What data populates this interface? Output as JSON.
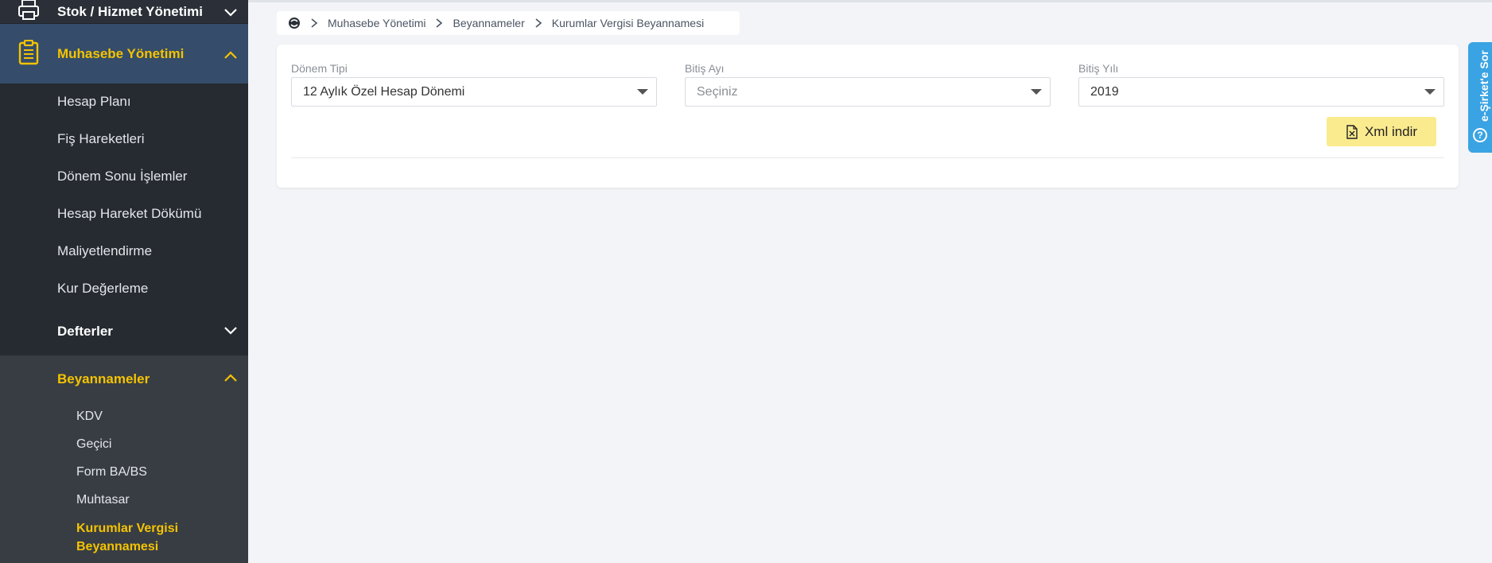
{
  "sidebar": {
    "top_item": {
      "label": "Stok / Hizmet Yönetimi",
      "icon": "printer-icon"
    },
    "active_section": {
      "label": "Muhasebe Yönetimi",
      "icon": "clipboard-icon"
    },
    "sub_items": [
      {
        "label": "Hesap Planı"
      },
      {
        "label": "Fiş Hareketleri"
      },
      {
        "label": "Dönem Sonu İşlemler"
      },
      {
        "label": "Hesap Hareket Dökümü"
      },
      {
        "label": "Maliyetlendirme"
      },
      {
        "label": "Kur Değerleme"
      }
    ],
    "defterler": {
      "label": "Defterler"
    },
    "beyannameler": {
      "label": "Beyannameler",
      "items": [
        {
          "label": "KDV"
        },
        {
          "label": "Geçici"
        },
        {
          "label": "Form BA/BS"
        },
        {
          "label": "Muhtasar"
        },
        {
          "label": "Kurumlar Vergisi Beyannamesi"
        }
      ]
    }
  },
  "breadcrumb": {
    "items": [
      "Muhasebe Yönetimi",
      "Beyannameler",
      "Kurumlar Vergisi Beyannamesi"
    ]
  },
  "form": {
    "donem_tipi": {
      "label": "Dönem Tipi",
      "value": "12 Aylık Özel Hesap Dönemi"
    },
    "bitis_ayi": {
      "label": "Bitiş Ayı",
      "placeholder": "Seçiniz"
    },
    "bitis_yili": {
      "label": "Bitiş Yılı",
      "value": "2019"
    },
    "xml_button": {
      "label": "Xml indir"
    }
  },
  "side_tab": {
    "label": "e-Şirket'e Sor"
  },
  "colors": {
    "sidebar_bg": "#262b31",
    "active_section_bg": "#354d6a",
    "accent_yellow": "#f4c300",
    "button_yellow": "#fbeb8f",
    "side_tab_blue": "#3aa3e3"
  }
}
